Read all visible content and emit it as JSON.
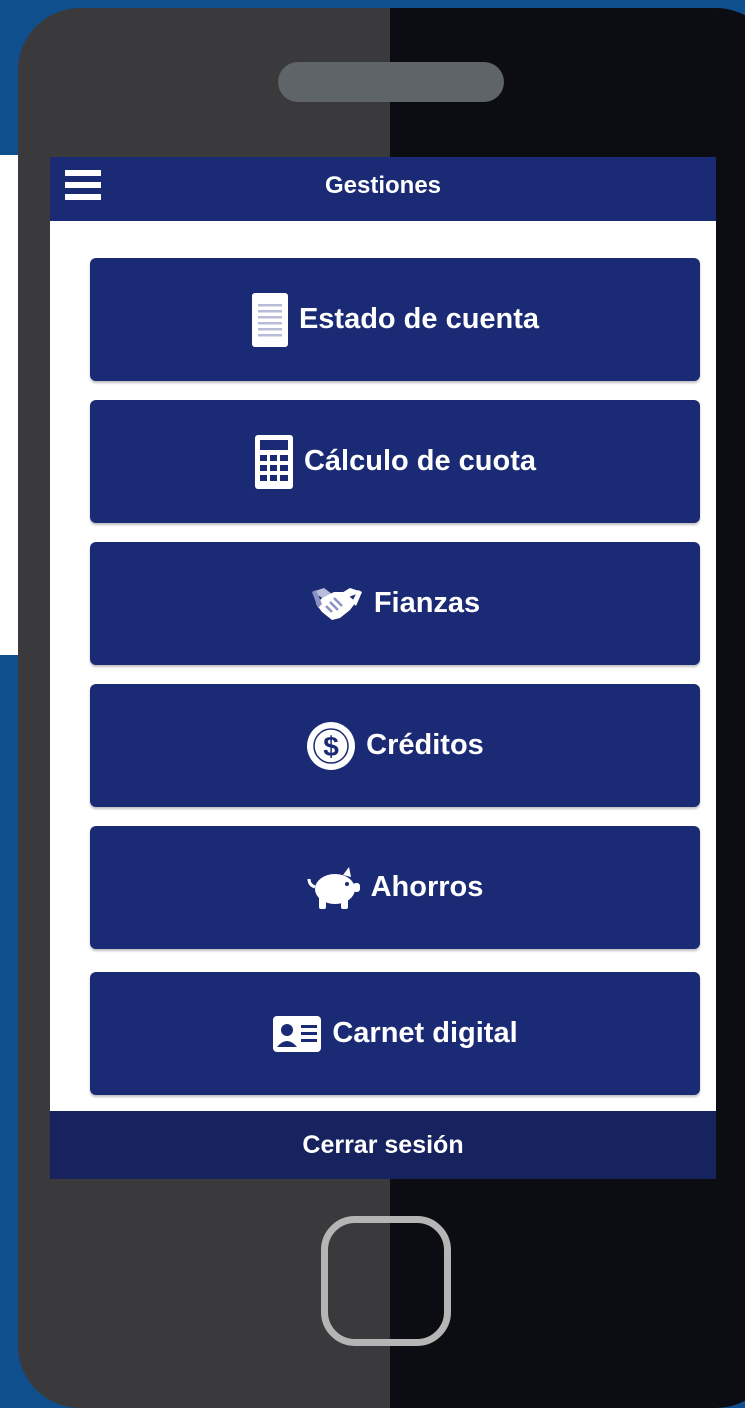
{
  "app": {
    "title": "Gestiones",
    "logout_label": "Cerrar sesión"
  },
  "menu": {
    "items": [
      {
        "label": "Estado de cuenta",
        "icon": "document-icon"
      },
      {
        "label": "Cálculo de cuota",
        "icon": "calculator-icon"
      },
      {
        "label": "Fianzas",
        "icon": "handshake-icon"
      },
      {
        "label": "Créditos",
        "icon": "dollar-coin-icon"
      },
      {
        "label": "Ahorros",
        "icon": "piggy-bank-icon"
      },
      {
        "label": "Carnet digital",
        "icon": "id-card-icon"
      }
    ]
  },
  "colors": {
    "primary": "#1b2a74",
    "footer": "#16235e",
    "background": "#0f4f8d"
  }
}
